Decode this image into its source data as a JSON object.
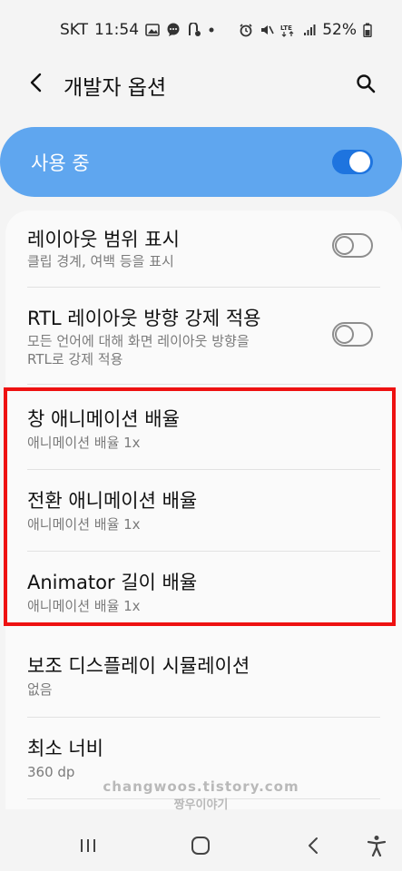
{
  "status_bar": {
    "carrier": "SKT",
    "time": "11:54",
    "battery": "52%",
    "left_icons": [
      "image-icon",
      "chat-icon",
      "sns-icon",
      "dot-icon"
    ],
    "right_icons": [
      "alarm-icon",
      "mute-icon",
      "lte-icon",
      "signal-icon",
      "battery-icon"
    ]
  },
  "app_bar": {
    "title": "개발자 옵션",
    "back_icon": "back-arrow-icon",
    "search_icon": "search-icon"
  },
  "master_switch": {
    "label": "사용 중",
    "state": "on"
  },
  "settings": [
    {
      "title": "레이아웃 범위 표시",
      "subtitle": "클립 경계, 여백 등을 표시",
      "toggle": "off"
    },
    {
      "title": "RTL 레이아웃 방향 강제 적용",
      "subtitle_lines": [
        "모든 언어에 대해 화면 레이아웃 방향을",
        "RTL로 강제 적용"
      ],
      "toggle": "off"
    },
    {
      "title": "창 애니메이션 배율",
      "subtitle": "애니메이션 배율 1x"
    },
    {
      "title": "전환 애니메이션 배율",
      "subtitle": "애니메이션 배율 1x"
    },
    {
      "title": "Animator 길이 배율",
      "subtitle": "애니메이션 배율 1x"
    },
    {
      "title": "보조 디스플레이 시뮬레이션",
      "subtitle": "없음"
    },
    {
      "title": "최소 너비",
      "subtitle": "360 dp"
    }
  ],
  "watermark": {
    "line1": "changwoos.tistory.com",
    "line2": "짱우이야기"
  },
  "nav_bar": {
    "icons": [
      "recent-apps-icon",
      "home-icon",
      "back-icon",
      "accessibility-icon"
    ]
  },
  "colors": {
    "master_bg": "#5fa6ef",
    "toggle_on": "#1e74df",
    "highlight": "#ee1111"
  }
}
